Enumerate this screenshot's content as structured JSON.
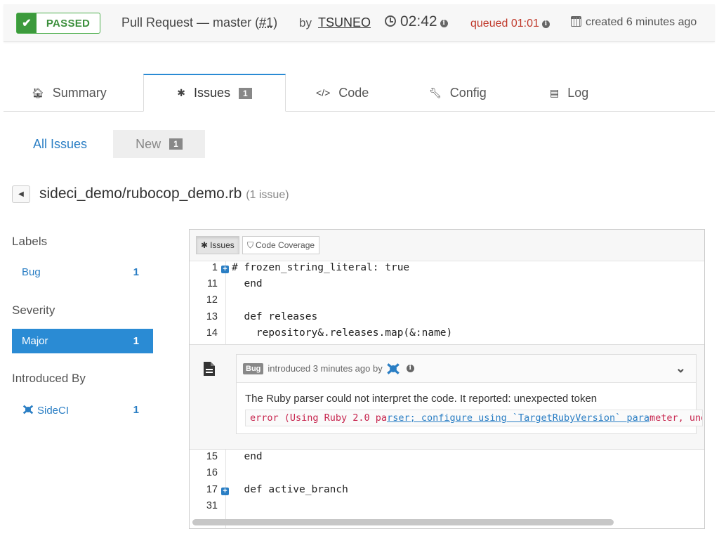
{
  "header": {
    "status": "PASSED",
    "title": "Pull Request — master (",
    "pr_number": "#1",
    "title_close": ")",
    "by": "by",
    "user": "TSUNEO",
    "duration": "02:42",
    "queued": "queued 01:01",
    "created": "created 6 minutes ago"
  },
  "tabs": [
    {
      "label": "Summary",
      "icon": "home-icon"
    },
    {
      "label": "Issues",
      "icon": "bug-icon",
      "count": "1",
      "active": true
    },
    {
      "label": "Code",
      "icon": "code-icon"
    },
    {
      "label": "Config",
      "icon": "wrench-icon"
    },
    {
      "label": "Log",
      "icon": "file-icon"
    }
  ],
  "subnav": {
    "all": "All Issues",
    "new": "New",
    "new_count": "1"
  },
  "file": {
    "path": "sideci_demo/rubocop_demo.rb",
    "count": "(1 issue)"
  },
  "sidebar": {
    "labels_heading": "Labels",
    "labels": [
      {
        "label": "Bug",
        "count": "1"
      }
    ],
    "severity_heading": "Severity",
    "severity": [
      {
        "label": "Major",
        "count": "1",
        "selected": true
      }
    ],
    "introduced_heading": "Introduced By",
    "introduced": [
      {
        "label": "SideCI",
        "count": "1"
      }
    ]
  },
  "panel": {
    "tab_issues": "Issues",
    "tab_coverage": "Code Coverage",
    "lines_top": [
      {
        "n": "1",
        "code": "# frozen_string_literal: true",
        "expand": true
      },
      {
        "n": "11",
        "code": "  end"
      },
      {
        "n": "12",
        "code": ""
      },
      {
        "n": "13",
        "code": "  def releases"
      },
      {
        "n": "14",
        "code": "    repository&.releases.map(&:name)"
      }
    ],
    "lines_bottom": [
      {
        "n": "15",
        "code": "  end"
      },
      {
        "n": "16",
        "code": ""
      },
      {
        "n": "17",
        "code": "  def active_branch",
        "expand": true
      },
      {
        "n": "31",
        "code": ""
      }
    ],
    "issue": {
      "tag": "Bug",
      "introduced": "introduced 3 minutes ago by",
      "message": "The Ruby parser could not interpret the code. It reported: unexpected token",
      "code_pre": "error (Using Ruby 2.0 pa",
      "code_link": "rser; configure using `TargetRubyVersion` para",
      "code_post": "meter, under"
    }
  },
  "colors": {
    "accent": "#2a8bd4",
    "passed": "#3c9a3c",
    "queued": "#c0392b"
  }
}
